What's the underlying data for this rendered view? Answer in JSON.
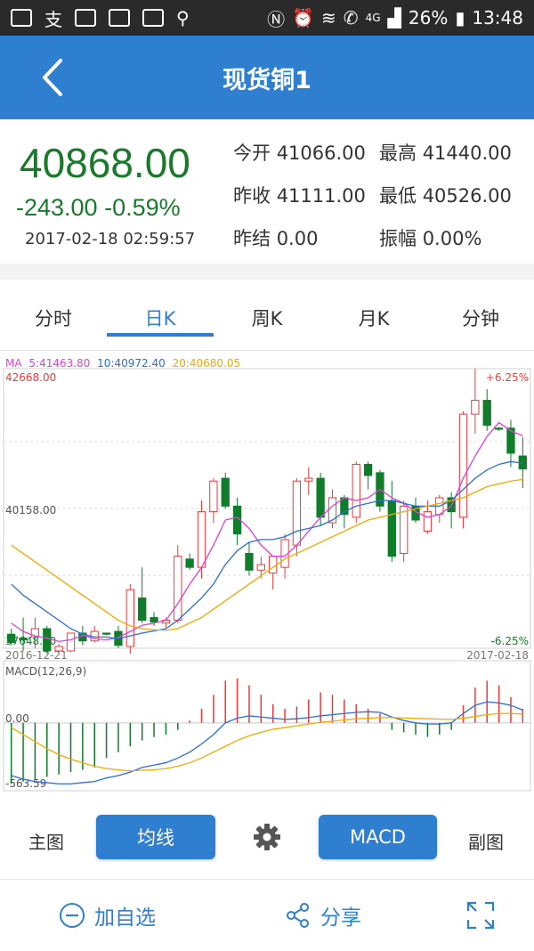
{
  "status": {
    "battery": "26%",
    "time": "13:48",
    "network": "4G"
  },
  "header": {
    "title": "现货铜1"
  },
  "quote": {
    "price": "40868.00",
    "change": "-243.00 -0.59%",
    "datetime": "2017-02-18 02:59:57",
    "open_label": "今开",
    "open": "41066.00",
    "high_label": "最高",
    "high": "41440.00",
    "prev_close_label": "昨收",
    "prev_close": "41111.00",
    "low_label": "最低",
    "low": "40526.00",
    "prev_settle_label": "昨结",
    "prev_settle": "0.00",
    "amp_label": "振幅",
    "amp": "0.00%"
  },
  "tabs": [
    {
      "label": "分时"
    },
    {
      "label": "日K"
    },
    {
      "label": "周K"
    },
    {
      "label": "月K"
    },
    {
      "label": "分钟"
    }
  ],
  "active_tab": 1,
  "chart_labels": {
    "ma_prefix": "MA",
    "ma5": "5:41463.80",
    "ma10": "10:40972.40",
    "ma20": "20:40680.05",
    "top_price": "42668.00",
    "mid_price": "40158.00",
    "bottom_price": "37648.00",
    "top_pct": "+6.25%",
    "bottom_pct": "-6.25%",
    "start_date": "2016-12-21",
    "end_date": "2017-02-18",
    "macd_title": "MACD(12,26,9)",
    "macd_zero": "0.00",
    "macd_min": "-563.59"
  },
  "chart_data": {
    "type": "candlestick",
    "ylim": [
      37648,
      42668
    ],
    "candles": [
      {
        "o": 37900,
        "h": 38000,
        "l": 37700,
        "c": 37750
      },
      {
        "o": 37830,
        "h": 38200,
        "l": 37600,
        "c": 37800
      },
      {
        "o": 37850,
        "h": 38200,
        "l": 37650,
        "c": 38000
      },
      {
        "o": 38000,
        "h": 38050,
        "l": 37550,
        "c": 37600
      },
      {
        "o": 37600,
        "h": 37720,
        "l": 37580,
        "c": 37680
      },
      {
        "o": 37600,
        "h": 37800,
        "l": 37580,
        "c": 37920
      },
      {
        "o": 37920,
        "h": 38050,
        "l": 37700,
        "c": 37780
      },
      {
        "o": 37780,
        "h": 38050,
        "l": 37750,
        "c": 37950
      },
      {
        "o": 37920,
        "h": 37930,
        "l": 37880,
        "c": 37900
      },
      {
        "o": 37950,
        "h": 38050,
        "l": 37650,
        "c": 37700
      },
      {
        "o": 37680,
        "h": 38800,
        "l": 37550,
        "c": 38700
      },
      {
        "o": 38550,
        "h": 39100,
        "l": 38100,
        "c": 38150
      },
      {
        "o": 38200,
        "h": 38300,
        "l": 38050,
        "c": 38120
      },
      {
        "o": 38100,
        "h": 38200,
        "l": 38020,
        "c": 38150
      },
      {
        "o": 38150,
        "h": 39500,
        "l": 38100,
        "c": 39300
      },
      {
        "o": 39250,
        "h": 39350,
        "l": 39050,
        "c": 39100
      },
      {
        "o": 39100,
        "h": 40300,
        "l": 38900,
        "c": 40100
      },
      {
        "o": 40100,
        "h": 40700,
        "l": 39900,
        "c": 40650
      },
      {
        "o": 40700,
        "h": 40800,
        "l": 40150,
        "c": 40200
      },
      {
        "o": 40200,
        "h": 40350,
        "l": 39500,
        "c": 39700
      },
      {
        "o": 39350,
        "h": 39550,
        "l": 38950,
        "c": 39050
      },
      {
        "o": 39050,
        "h": 39300,
        "l": 38900,
        "c": 39150
      },
      {
        "o": 39000,
        "h": 39250,
        "l": 38700,
        "c": 39300
      },
      {
        "o": 39100,
        "h": 39700,
        "l": 38900,
        "c": 39600
      },
      {
        "o": 39500,
        "h": 40700,
        "l": 39300,
        "c": 40650
      },
      {
        "o": 40650,
        "h": 40900,
        "l": 40400,
        "c": 40700
      },
      {
        "o": 40700,
        "h": 40800,
        "l": 39850,
        "c": 40000
      },
      {
        "o": 39900,
        "h": 40500,
        "l": 39800,
        "c": 40350
      },
      {
        "o": 40350,
        "h": 40400,
        "l": 39800,
        "c": 40050
      },
      {
        "o": 40000,
        "h": 41000,
        "l": 39900,
        "c": 40950
      },
      {
        "o": 40950,
        "h": 41000,
        "l": 40500,
        "c": 40750
      },
      {
        "o": 40800,
        "h": 40850,
        "l": 40100,
        "c": 40200
      },
      {
        "o": 40300,
        "h": 40650,
        "l": 39200,
        "c": 39300
      },
      {
        "o": 39350,
        "h": 40300,
        "l": 39200,
        "c": 40200
      },
      {
        "o": 40200,
        "h": 40350,
        "l": 39900,
        "c": 39950
      },
      {
        "o": 39750,
        "h": 40300,
        "l": 39700,
        "c": 40100
      },
      {
        "o": 40050,
        "h": 40400,
        "l": 39900,
        "c": 40350
      },
      {
        "o": 40350,
        "h": 40450,
        "l": 39800,
        "c": 40100
      },
      {
        "o": 40000,
        "h": 41900,
        "l": 39800,
        "c": 41850
      },
      {
        "o": 41850,
        "h": 42668,
        "l": 41500,
        "c": 42100
      },
      {
        "o": 42100,
        "h": 42300,
        "l": 41550,
        "c": 41650
      },
      {
        "o": 41600,
        "h": 41620,
        "l": 41550,
        "c": 41580
      },
      {
        "o": 41600,
        "h": 41750,
        "l": 40900,
        "c": 41150
      },
      {
        "o": 41100,
        "h": 41440,
        "l": 40526,
        "c": 40868
      }
    ],
    "ma5": [
      38100,
      37950,
      37870,
      37830,
      37770,
      37800,
      37880,
      37820,
      37800,
      37840,
      37950,
      38060,
      38100,
      38150,
      38450,
      38800,
      39100,
      39500,
      39950,
      40000,
      39800,
      39500,
      39300,
      39300,
      39500,
      39750,
      40000,
      40200,
      40350,
      40300,
      40350,
      40500,
      40350,
      40250,
      40100,
      40000,
      40050,
      40200,
      40700,
      41100,
      41450,
      41700,
      41550,
      41463
    ],
    "ma10": [
      38800,
      38600,
      38450,
      38300,
      38150,
      38000,
      37900,
      37850,
      37850,
      37820,
      37870,
      37920,
      37960,
      38000,
      38150,
      38350,
      38550,
      38800,
      39150,
      39400,
      39550,
      39600,
      39600,
      39650,
      39750,
      39800,
      39850,
      39950,
      40100,
      40200,
      40250,
      40300,
      40300,
      40250,
      40200,
      40200,
      40200,
      40300,
      40500,
      40700,
      40850,
      40950,
      41000,
      40972
    ],
    "ma20": [
      39500,
      39350,
      39200,
      39050,
      38900,
      38750,
      38600,
      38450,
      38300,
      38150,
      38050,
      38000,
      37980,
      37970,
      38000,
      38100,
      38200,
      38350,
      38500,
      38650,
      38800,
      38950,
      39100,
      39250,
      39350,
      39450,
      39550,
      39650,
      39750,
      39850,
      39950,
      40000,
      40050,
      40100,
      40150,
      40200,
      40250,
      40300,
      40350,
      40450,
      40550,
      40600,
      40650,
      40680
    ],
    "macd_hist": [
      -520,
      -500,
      -480,
      -460,
      -440,
      -420,
      -400,
      -380,
      -300,
      -250,
      -200,
      -150,
      -120,
      -100,
      -60,
      20,
      120,
      240,
      360,
      380,
      320,
      240,
      160,
      120,
      140,
      200,
      260,
      240,
      200,
      160,
      120,
      80,
      -60,
      -80,
      -100,
      -120,
      -100,
      -60,
      150,
      300,
      360,
      320,
      220,
      120
    ],
    "macd_dif": [
      -450,
      -480,
      -500,
      -510,
      -520,
      -520,
      -510,
      -500,
      -470,
      -450,
      -420,
      -380,
      -360,
      -340,
      -300,
      -250,
      -180,
      -100,
      0,
      40,
      60,
      50,
      40,
      30,
      35,
      45,
      60,
      70,
      80,
      90,
      95,
      90,
      50,
      20,
      0,
      -10,
      -10,
      0,
      80,
      150,
      180,
      170,
      150,
      110
    ],
    "macd_dea": [
      -40,
      -100,
      -160,
      -220,
      -270,
      -310,
      -340,
      -370,
      -390,
      -400,
      -410,
      -405,
      -400,
      -390,
      -370,
      -340,
      -300,
      -250,
      -200,
      -150,
      -110,
      -80,
      -55,
      -40,
      -25,
      -10,
      5,
      15,
      25,
      35,
      40,
      45,
      45,
      42,
      38,
      35,
      32,
      30,
      40,
      55,
      70,
      80,
      80,
      75
    ],
    "macd_ylim": [
      -563.59,
      500
    ]
  },
  "toolbar": {
    "main_label": "主图",
    "ma_button": "均线",
    "macd_button": "MACD",
    "sub_label": "副图"
  },
  "bottom": {
    "add_watch": "加自选",
    "share": "分享"
  },
  "colors": {
    "up": "#f03a3a",
    "down": "#0f7d2a",
    "ma5": "#e23fd6",
    "ma10": "#2a6fd6",
    "ma20": "#f5a800",
    "accent": "#2f7fd1"
  }
}
